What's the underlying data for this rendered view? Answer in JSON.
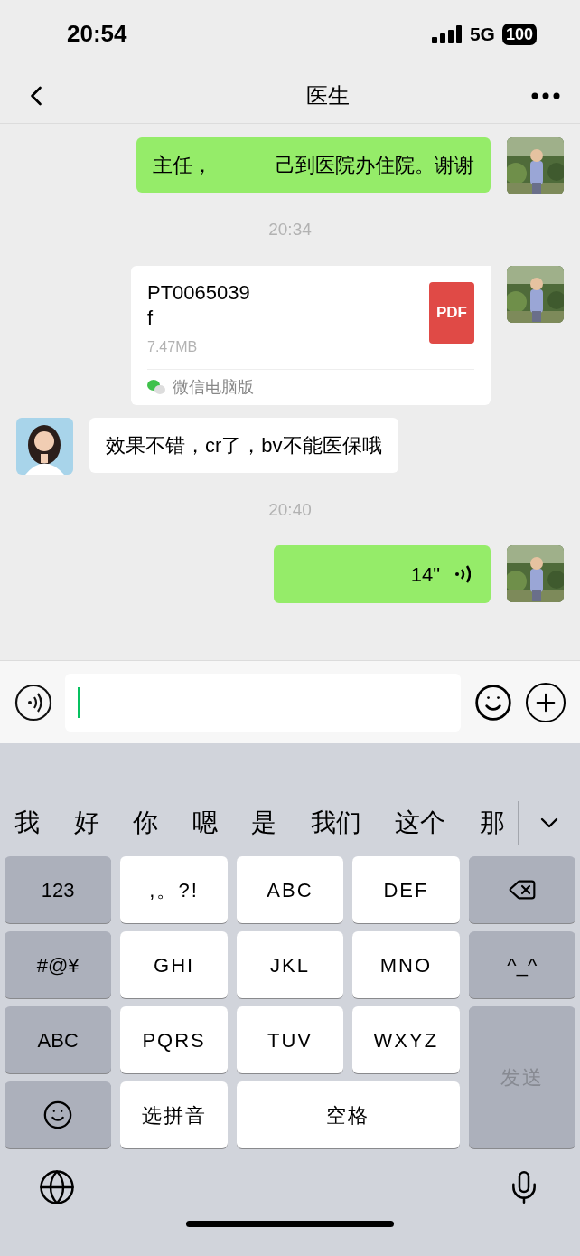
{
  "status_bar": {
    "time": "20:54",
    "network": "5G",
    "battery": "100"
  },
  "header": {
    "title": "医生"
  },
  "messages": [
    {
      "kind": "text",
      "outgoing": true,
      "parts": [
        "主任，",
        "己到医院办住院。谢谢"
      ]
    },
    {
      "kind": "time",
      "text": "20:34"
    },
    {
      "kind": "file",
      "outgoing": true,
      "name_lines": [
        "PT0065039",
        "f"
      ],
      "size": "7.47MB",
      "source": "微信电脑版",
      "badge": "PDF"
    },
    {
      "kind": "text",
      "outgoing": false,
      "parts": [
        "效果不错，cr了，bv不能医保哦"
      ]
    },
    {
      "kind": "time",
      "text": "20:40"
    },
    {
      "kind": "voice",
      "outgoing": true,
      "duration": "14\""
    }
  ],
  "candidates": [
    "我",
    "好",
    "你",
    "嗯",
    "是",
    "我们",
    "这个",
    "那"
  ],
  "keys": [
    {
      "kind": "function",
      "label": "123"
    },
    {
      "kind": "letter",
      "label": ",。?!"
    },
    {
      "kind": "letter",
      "label": "ABC"
    },
    {
      "kind": "letter",
      "label": "DEF"
    },
    {
      "kind": "delete"
    },
    {
      "kind": "function",
      "label": "#@¥"
    },
    {
      "kind": "letter",
      "label": "GHI"
    },
    {
      "kind": "letter",
      "label": "JKL"
    },
    {
      "kind": "letter",
      "label": "MNO"
    },
    {
      "kind": "function",
      "label": "^_^"
    },
    {
      "kind": "function",
      "label": "ABC"
    },
    {
      "kind": "letter",
      "label": "PQRS"
    },
    {
      "kind": "letter",
      "label": "TUV"
    },
    {
      "kind": "letter",
      "label": "WXYZ"
    },
    {
      "kind": "send",
      "label": "发送",
      "disabled": true
    },
    {
      "kind": "emoji"
    },
    {
      "kind": "letter",
      "label": "选拼音"
    },
    {
      "kind": "space",
      "label": "空格"
    }
  ]
}
